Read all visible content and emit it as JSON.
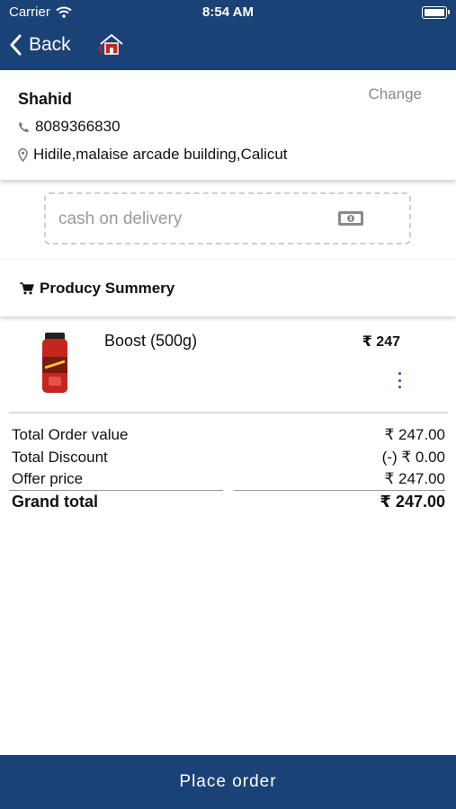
{
  "status_bar": {
    "carrier": "Carrier",
    "time": "8:54 AM"
  },
  "nav": {
    "back_label": "Back"
  },
  "address": {
    "name": "Shahid",
    "change_label": "Change",
    "phone": "8089366830",
    "location": "Hidile,malaise arcade building,Calicut"
  },
  "payment": {
    "method": "cash on delivery"
  },
  "summary": {
    "title": "Producy Summery"
  },
  "product": {
    "name": "Boost (500g)",
    "price": "₹ 247"
  },
  "totals": {
    "rows": [
      {
        "label": "Total Order value",
        "value": "₹ 247.00"
      },
      {
        "label": "Total Discount",
        "value": "(-) ₹ 0.00"
      },
      {
        "label": "Offer price",
        "value": "₹ 247.00"
      }
    ],
    "grand_label": "Grand total",
    "grand_value": "₹ 247.00"
  },
  "footer": {
    "place_order_label": "Place order"
  },
  "colors": {
    "primary": "#1a4276",
    "accent_blue": "#1f4fbf",
    "product_red": "#c4261b"
  }
}
